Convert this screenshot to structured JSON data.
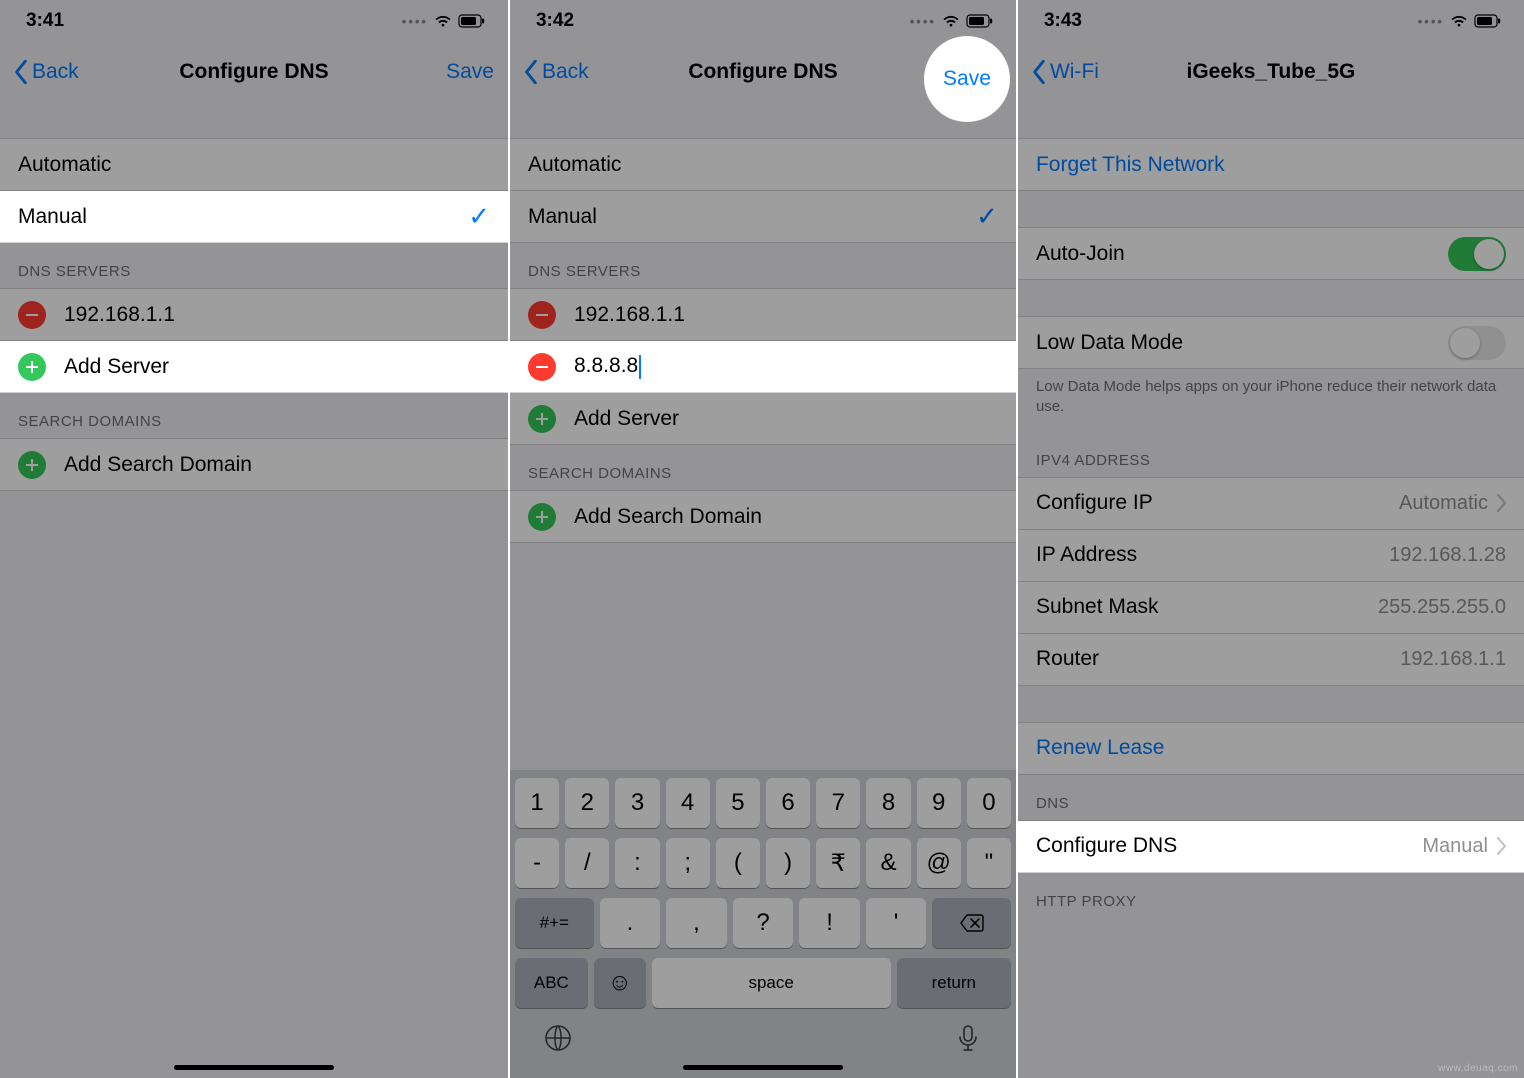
{
  "p1": {
    "time": "3:41",
    "back": "Back",
    "title": "Configure DNS",
    "save": "Save",
    "opt_auto": "Automatic",
    "opt_manual": "Manual",
    "hdr_dns": "DNS SERVERS",
    "server1": "192.168.1.1",
    "add_server": "Add Server",
    "hdr_search": "SEARCH DOMAINS",
    "add_domain": "Add Search Domain"
  },
  "p2": {
    "time": "3:42",
    "back": "Back",
    "title": "Configure DNS",
    "save": "Save",
    "opt_auto": "Automatic",
    "opt_manual": "Manual",
    "hdr_dns": "DNS SERVERS",
    "server1": "192.168.1.1",
    "server2": "8.8.8.8",
    "add_server": "Add Server",
    "hdr_search": "SEARCH DOMAINS",
    "add_domain": "Add Search Domain",
    "keys_r1": [
      "1",
      "2",
      "3",
      "4",
      "5",
      "6",
      "7",
      "8",
      "9",
      "0"
    ],
    "keys_r2": [
      "-",
      "/",
      ":",
      ";",
      "(",
      ")",
      "₹",
      "&",
      "@",
      "\""
    ],
    "key_symbols": "#+=",
    "key_period": ".",
    "key_comma": ",",
    "key_question": "?",
    "key_excl": "!",
    "key_apos": "'",
    "key_abc": "ABC",
    "key_space": "space",
    "key_return": "return"
  },
  "p3": {
    "time": "3:43",
    "back": "Wi-Fi",
    "title": "iGeeks_Tube_5G",
    "forget": "Forget This Network",
    "autojoin": "Auto-Join",
    "lowdata": "Low Data Mode",
    "lowdata_help": "Low Data Mode helps apps on your iPhone reduce their network data use.",
    "hdr_ipv4": "IPV4 ADDRESS",
    "cfg_ip_label": "Configure IP",
    "cfg_ip_value": "Automatic",
    "ip_label": "IP Address",
    "ip_value": "192.168.1.28",
    "mask_label": "Subnet Mask",
    "mask_value": "255.255.255.0",
    "router_label": "Router",
    "router_value": "192.168.1.1",
    "renew": "Renew Lease",
    "hdr_dns": "DNS",
    "cfg_dns_label": "Configure DNS",
    "cfg_dns_value": "Manual",
    "hdr_proxy": "HTTP PROXY"
  },
  "watermark": "www.deuaq.com"
}
